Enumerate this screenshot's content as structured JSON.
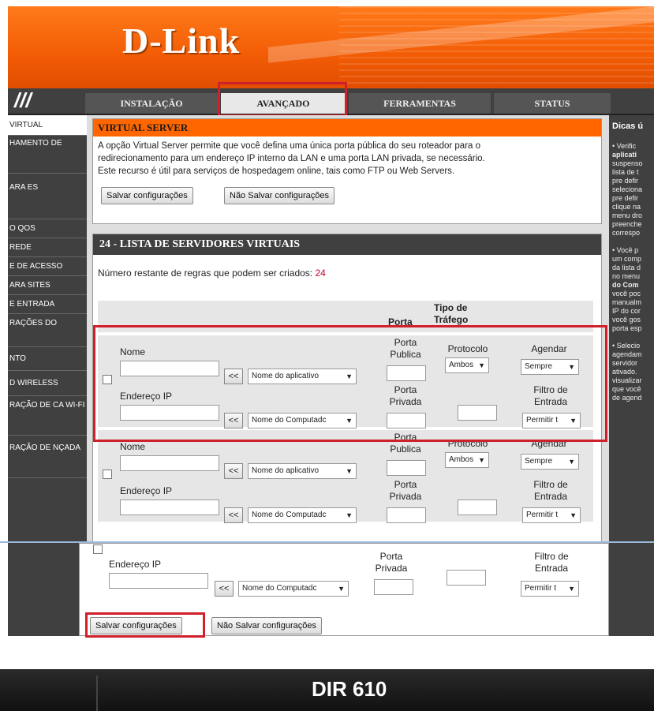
{
  "brand": {
    "logo": "D-Link"
  },
  "nav": {
    "tabs": [
      {
        "label": "INSTALAÇÃO"
      },
      {
        "label": "AVANÇADO"
      },
      {
        "label": "FERRAMENTAS"
      },
      {
        "label": "STATUS"
      }
    ],
    "active_index": 1
  },
  "sidebar": {
    "items": [
      {
        "label": "VIRTUAL"
      },
      {
        "label": "HAMENTO DE"
      },
      {
        "label": "ARA ES"
      },
      {
        "label": "O QOS"
      },
      {
        "label": "REDE"
      },
      {
        "label": "E DE ACESSO"
      },
      {
        "label": "ARA SITES"
      },
      {
        "label": "E ENTRADA"
      },
      {
        "label": "RAÇÕES DO"
      },
      {
        "label": "NTO"
      },
      {
        "label": "D WIRELESS"
      },
      {
        "label": "RAÇÃO DE CA WI-FI"
      },
      {
        "label": "RAÇÃO DE NÇADA"
      }
    ]
  },
  "virtual_server": {
    "title": "VIRTUAL SERVER",
    "description_lines": [
      "A opção Virtual Server permite que você defina uma única porta pública do seu roteador para o",
      "redirecionamento para um endereço IP interno da LAN e uma porta LAN privada, se necessário.",
      "Este recurso é útil para serviços de hospedagem online, tais como FTP ou Web Servers."
    ],
    "save_label": "Salvar configurações",
    "nosave_label": "Não Salvar configurações"
  },
  "list": {
    "title": "24 - LISTA DE SERVIDORES VIRTUAIS",
    "remaining_text": "Número restante de regras que podem ser criados:",
    "remaining_count": "24",
    "col_porta": "Porta",
    "col_tipo": "Tipo de Tráfego",
    "labels": {
      "nome": "Nome",
      "endereco_ip": "Endereço IP",
      "porta_publica": "Porta Publica",
      "porta_privada": "Porta Privada",
      "protocolo": "Protocolo",
      "agendar": "Agendar",
      "filtro": "Filtro de Entrada",
      "arrow_btn": "<<",
      "app_select": "Nome do aplicativo",
      "comp_select": "Nome do Computadc",
      "proto_select": "Ambos",
      "sched_select": "Sempre",
      "filter_select": "Permitir t"
    }
  },
  "bottom": {
    "save_label": "Salvar configurações",
    "nosave_label": "Não Salvar configurações"
  },
  "tips": {
    "title": "Dicas ú",
    "lines": [
      "• Verific",
      "aplicati",
      "suspenso",
      "lista de t",
      "pre defir",
      "seleciona",
      "pre defir",
      "clique na",
      "menu dro",
      "preenche",
      "correspo",
      "",
      "• Você p",
      "um comp",
      "da lista d",
      "no menu",
      "do Com",
      "você poc",
      "manualm",
      "IP do cor",
      "você gos",
      "porta esp",
      "",
      "• Selecio",
      "agendam",
      "servidor",
      "ativado.",
      "visualizar",
      "que você",
      "de agend"
    ]
  },
  "device": {
    "model": "DIR 610"
  },
  "colors": {
    "orange": "#ff6600",
    "dark": "#404040",
    "highlight": "#d0202a"
  }
}
